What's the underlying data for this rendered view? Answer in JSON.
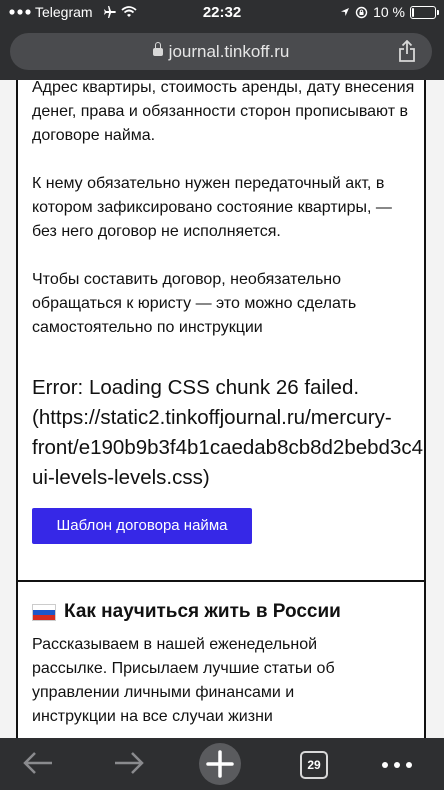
{
  "status_bar": {
    "carrier": "Telegram",
    "time": "22:32",
    "battery": "10 %",
    "battery_level": 0.1
  },
  "browser": {
    "url": "journal.tinkoff.ru",
    "tab_count": "29"
  },
  "article_card": {
    "paragraphs": [
      "Адрес квартиры, стоимость аренды, дату внесения денег, права и обязанности сторон прописывают в договоре найма.",
      "К нему обязательно нужен передаточный акт, в котором зафиксировано состояние квартиры, — без него договор не исполняется.",
      "Чтобы составить договор, необязательно обращаться к юристу — это можно сделать самостоятельно по инструкции"
    ],
    "error_text": "Error: Loading CSS chunk 26 failed.\n(https://static2.tinkoffjournal.ru/mercury-\nfront/e190b9b3f4b1caedab8cb8d2bebd3c4\nui-levels-levels.css)",
    "button_label": "Шаблон договора найма",
    "button_color": "#3628e7"
  },
  "newsletter_card": {
    "title": "Как научиться жить в России",
    "text": "Рассказываем в нашей еженедельной рассылке. Присылаем лучшие статьи об управлении личными финансами и инструкции на все случаи жизни"
  }
}
